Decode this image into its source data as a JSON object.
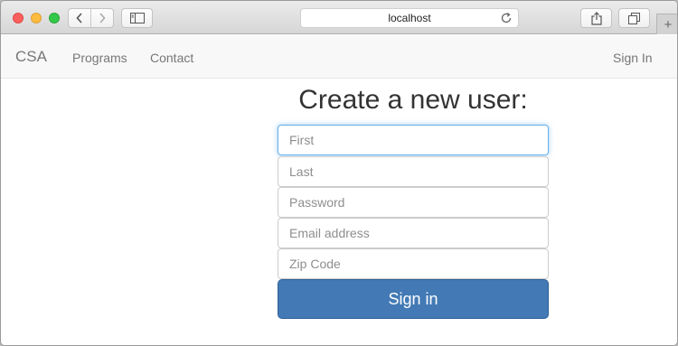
{
  "browser": {
    "address": "localhost",
    "icons": {
      "back": "chevron-left-icon",
      "forward": "chevron-right-icon",
      "sidebar": "sidebar-icon",
      "reload": "reload-icon",
      "share": "share-icon",
      "tabs": "tabs-overview-icon",
      "new_tab": "plus-icon"
    }
  },
  "navbar": {
    "brand": "CSA",
    "links": [
      "Programs",
      "Contact"
    ],
    "right_link": "Sign In"
  },
  "form": {
    "heading": "Create a new user:",
    "fields": [
      {
        "placeholder": "First",
        "value": ""
      },
      {
        "placeholder": "Last",
        "value": ""
      },
      {
        "placeholder": "Password",
        "value": ""
      },
      {
        "placeholder": "Email address",
        "value": ""
      },
      {
        "placeholder": "Zip Code",
        "value": ""
      }
    ],
    "submit_label": "Sign in"
  },
  "colors": {
    "primary_button": "#437ab5",
    "focus_ring": "#66afe9",
    "navbar_bg": "#f8f8f8"
  }
}
